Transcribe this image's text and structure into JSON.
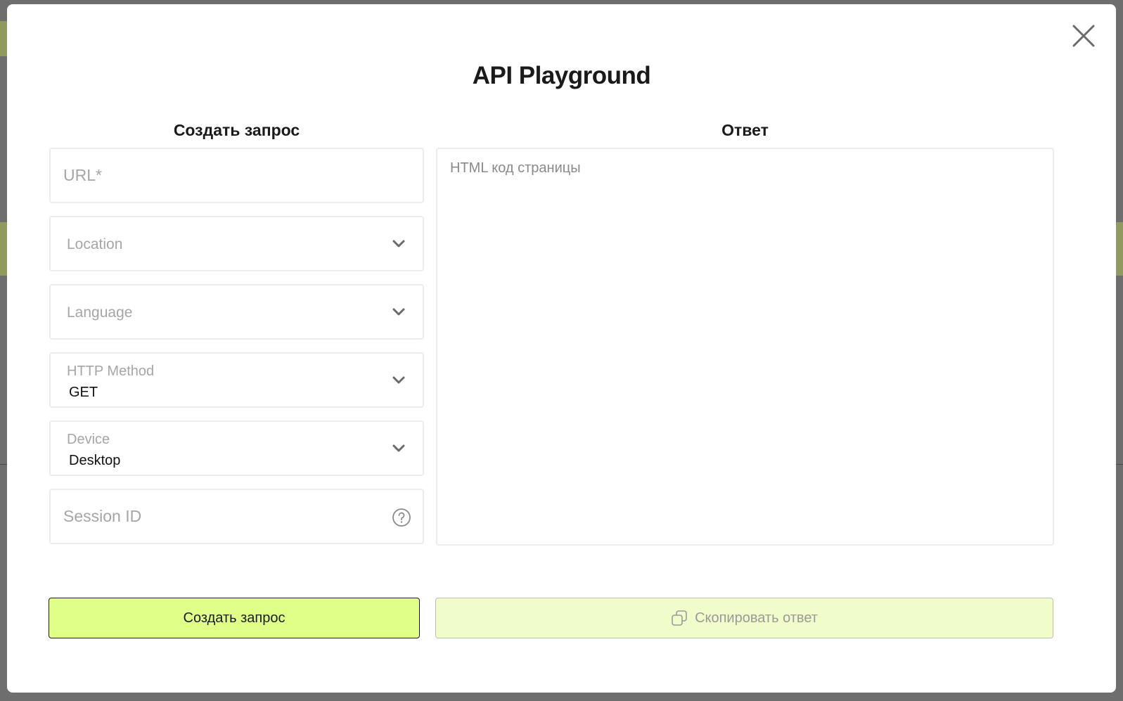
{
  "modal": {
    "title": "API Playground"
  },
  "request": {
    "heading": "Создать запрос",
    "url_placeholder": "URL*",
    "location_placeholder": "Location",
    "language_placeholder": "Language",
    "http_method": {
      "label": "HTTP Method",
      "value": "GET"
    },
    "device": {
      "label": "Device",
      "value": "Desktop"
    },
    "session_placeholder": "Session ID",
    "submit_label": "Создать запрос"
  },
  "response": {
    "heading": "Ответ",
    "placeholder": "HTML код страницы",
    "copy_label": "Скопировать ответ"
  },
  "icons": {
    "close": "close-icon",
    "chevron": "chevron-down-icon",
    "help": "help-icon",
    "copy": "copy-icon"
  },
  "colors": {
    "accent": "#e0ff88",
    "accent_disabled": "#f1fccb",
    "overlay": "#6e6e6e"
  }
}
